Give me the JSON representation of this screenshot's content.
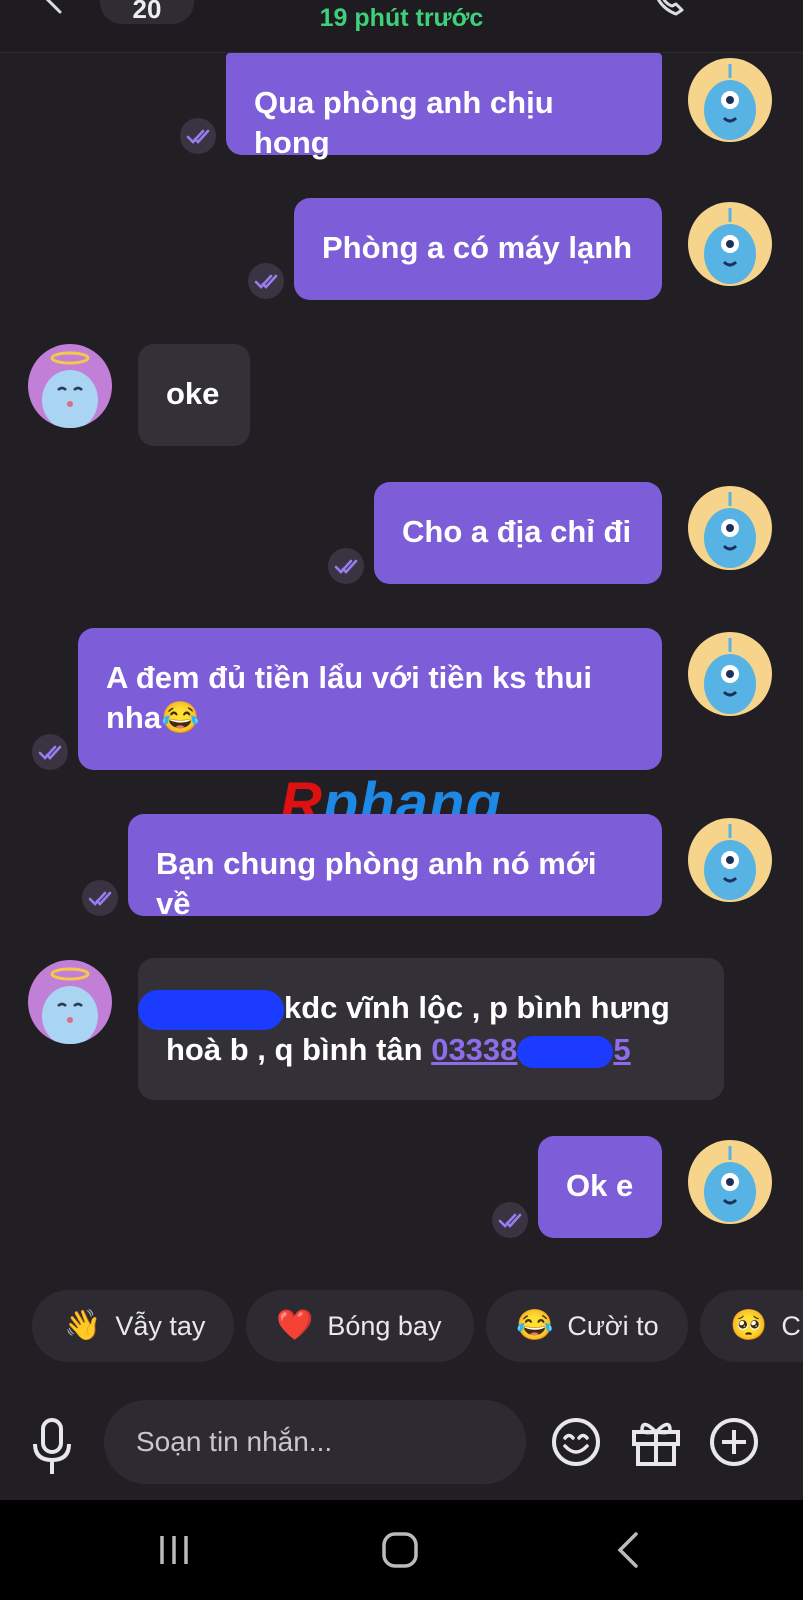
{
  "header": {
    "message_count": "20",
    "status": "19 phút trước"
  },
  "messages": [
    {
      "sender": "me",
      "text": "Qua phòng anh chịu hong",
      "status": "seen"
    },
    {
      "sender": "me",
      "text": "Phòng a có máy lạnh",
      "status": "seen"
    },
    {
      "sender": "them",
      "text": "oke"
    },
    {
      "sender": "me",
      "text": "Cho a địa chỉ đi",
      "status": "seen"
    },
    {
      "sender": "me",
      "text_line1": "A đem đủ tiền lẩu với tiền ks thui",
      "text_line2": "nha😂",
      "status": "seen"
    },
    {
      "sender": "me",
      "text": "Bạn chung phòng anh nó mới về",
      "status": "seen"
    },
    {
      "sender": "them",
      "text_line1": "kdc vĩnh lộc , p bình hưng",
      "text_line2": "hoà b , q bình tân ",
      "phone_visible": "03338",
      "phone_tail": "5"
    },
    {
      "sender": "me",
      "text": "Ok e",
      "status": "seen"
    }
  ],
  "watermark": {
    "first": "R",
    "rest": "phang"
  },
  "quick_reactions": [
    {
      "emoji": "👋",
      "label": "Vẫy tay"
    },
    {
      "emoji": "❤️",
      "label": "Bóng bay"
    },
    {
      "emoji": "😂",
      "label": "Cười to"
    },
    {
      "emoji": "🥺",
      "label": "C"
    }
  ],
  "composer": {
    "placeholder": "Soạn tin nhắn...",
    "icons": [
      "mic-icon",
      "sticker-smile-icon",
      "gift-icon",
      "plus-circle-icon"
    ]
  },
  "navbar": {
    "icons": [
      "recent-apps-icon",
      "home-icon",
      "back-icon"
    ]
  },
  "colors": {
    "background": "#211f24",
    "my_bubble": "#7e5dd8",
    "their_bubble": "#333038",
    "status_green": "#3fd07a",
    "link": "#8d6dea"
  }
}
